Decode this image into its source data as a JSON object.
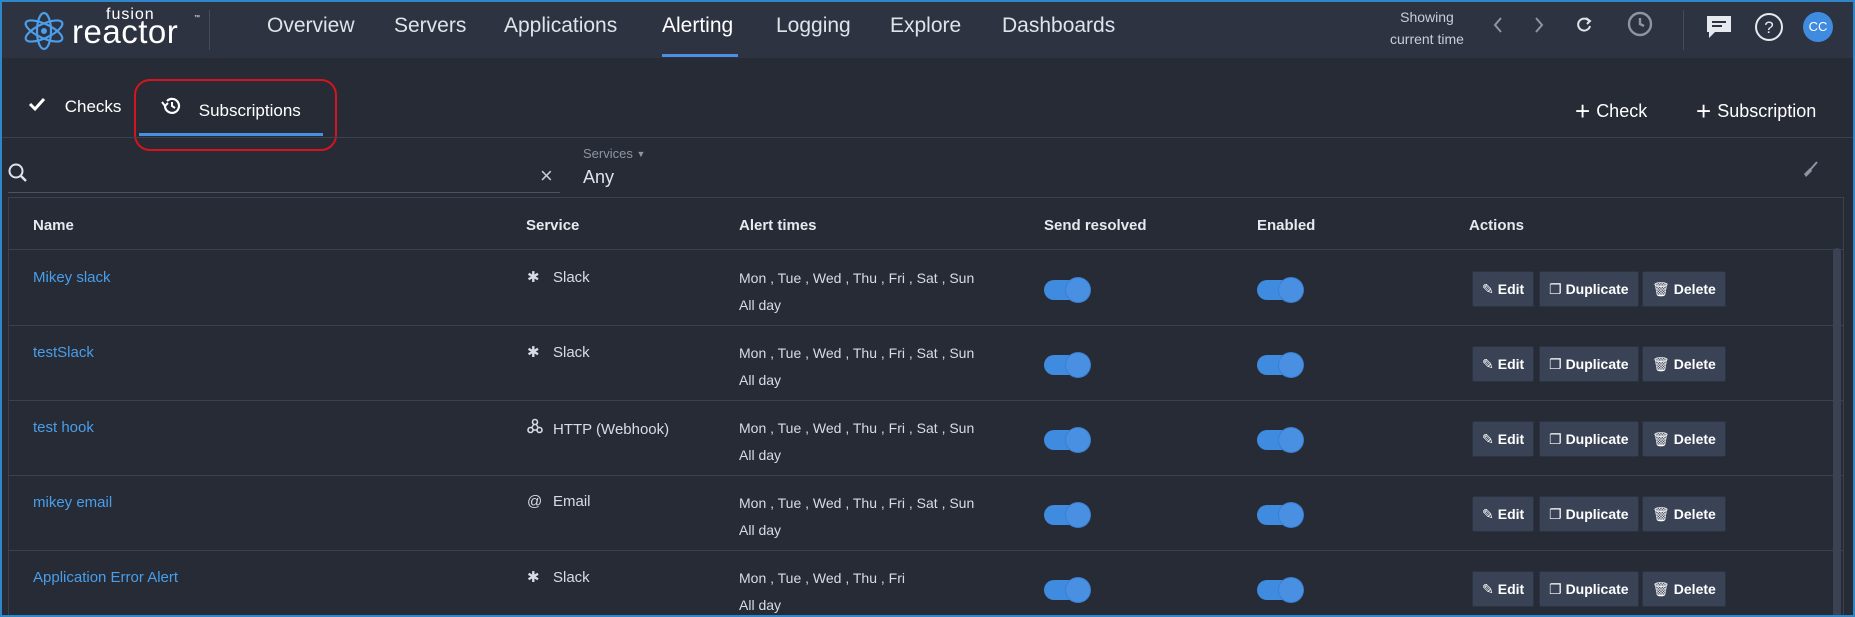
{
  "logo": {
    "fusion": "fusion",
    "reactor": "reactor",
    "tm": "™"
  },
  "nav": {
    "items": [
      "Overview",
      "Servers",
      "Applications",
      "Alerting",
      "Logging",
      "Explore",
      "Dashboards"
    ],
    "active": "Alerting"
  },
  "time": {
    "line1": "Showing",
    "line2": "current time"
  },
  "user": {
    "initials": "CC"
  },
  "subtabs": [
    {
      "label": "Checks",
      "icon": "check-icon"
    },
    {
      "label": "Subscriptions",
      "icon": "history-icon",
      "active": true
    }
  ],
  "actions": {
    "add_check": "Check",
    "add_subscription": "Subscription",
    "plus": "+"
  },
  "filters": {
    "search_value": "",
    "services_label": "Services",
    "services_value": "Any"
  },
  "table": {
    "headers": [
      "Name",
      "Service",
      "Alert times",
      "Send resolved",
      "Enabled",
      "Actions"
    ],
    "rows": [
      {
        "name": "Mikey slack",
        "service": "Slack",
        "service_icon": "slack-icon",
        "days": "Mon , Tue , Wed , Thu , Fri , Sat , Sun",
        "times": "All day",
        "send_resolved": true,
        "enabled": true
      },
      {
        "name": "testSlack",
        "service": "Slack",
        "service_icon": "slack-icon",
        "days": "Mon , Tue , Wed , Thu , Fri , Sat , Sun",
        "times": "All day",
        "send_resolved": true,
        "enabled": true
      },
      {
        "name": "test hook",
        "service": "HTTP (Webhook)",
        "service_icon": "webhook-icon",
        "days": "Mon , Tue , Wed , Thu , Fri , Sat , Sun",
        "times": "All day",
        "send_resolved": true,
        "enabled": true
      },
      {
        "name": "mikey email",
        "service": "Email",
        "service_icon": "at-icon",
        "days": "Mon , Tue , Wed , Thu , Fri , Sat , Sun",
        "times": "All day",
        "send_resolved": true,
        "enabled": true
      },
      {
        "name": "Application Error Alert",
        "service": "Slack",
        "service_icon": "slack-icon",
        "days": "Mon , Tue , Wed , Thu , Fri",
        "times": "All day",
        "send_resolved": true,
        "enabled": true
      }
    ],
    "row_buttons": {
      "edit": "Edit",
      "duplicate": "Duplicate",
      "delete": "Delete"
    }
  },
  "colors": {
    "accent": "#4a90e2",
    "background": "#262b36",
    "nav_bg": "#2d3341",
    "annotation": "#d5141d"
  }
}
